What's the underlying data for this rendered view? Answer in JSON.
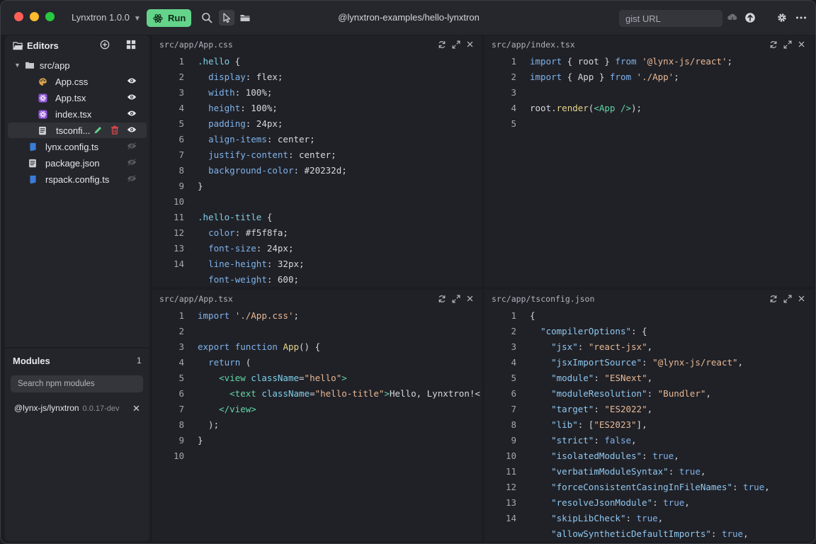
{
  "window": {
    "title": "@lynxtron-examples/hello-lynxtron",
    "version": "Lynxtron 1.0.0"
  },
  "toolbar": {
    "run_label": "Run",
    "gist_placeholder": "gist URL"
  },
  "sidebar": {
    "editors_label": "Editors",
    "folder_name": "src/app",
    "files_in_app": [
      "App.css",
      "App.tsx",
      "index.tsx",
      "tsconfi..."
    ],
    "root_files": [
      "lynx.config.ts",
      "package.json",
      "rspack.config.ts"
    ]
  },
  "modules": {
    "label": "Modules",
    "count": "1",
    "search_placeholder": "Search npm modules",
    "items": [
      {
        "name": "@lynx-js/lynxtron",
        "version": "0.0.17-dev"
      }
    ]
  },
  "panes": {
    "app_css": {
      "path": "src/app/App.css",
      "lines": [
        "1",
        "2",
        "3",
        "4",
        "5",
        "6",
        "7",
        "8",
        "9",
        "10",
        "11",
        "12",
        "13",
        "14",
        ""
      ]
    },
    "index_tsx": {
      "path": "src/app/index.tsx",
      "lines": [
        "1",
        "2",
        "3",
        "4",
        "5"
      ]
    },
    "app_tsx": {
      "path": "src/app/App.tsx",
      "lines": [
        "1",
        "2",
        "3",
        "4",
        "5",
        "6",
        "7",
        "8",
        "9",
        "10"
      ]
    },
    "tsconfig": {
      "path": "src/app/tsconfig.json",
      "lines": [
        "1",
        "2",
        "3",
        "4",
        "5",
        "6",
        "7",
        "8",
        "9",
        "10",
        "11",
        "12",
        "13",
        "14",
        ""
      ]
    }
  },
  "colors": {
    "accent_run": "#63d48a",
    "background": "#1c1d22",
    "pane": "#202127"
  }
}
